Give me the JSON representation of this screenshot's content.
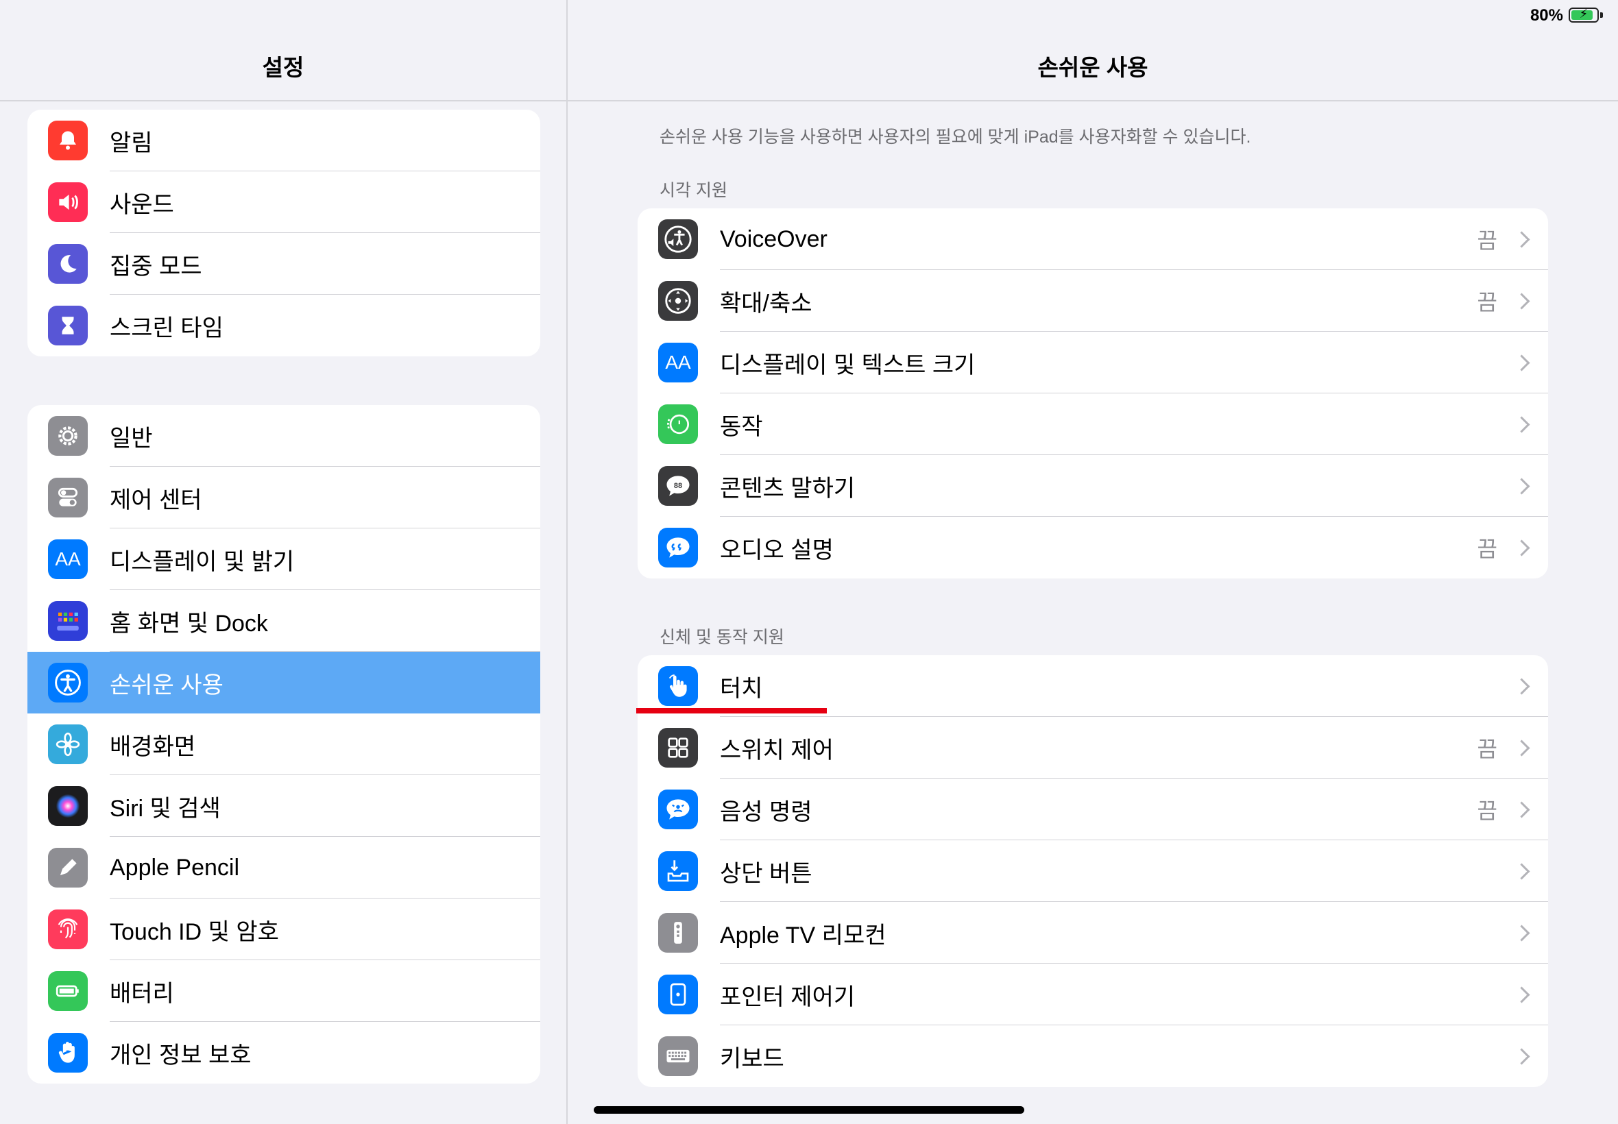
{
  "status_bar": {
    "battery_percent": "80%"
  },
  "sidebar": {
    "title": "설정",
    "group1": [
      {
        "label": "알림",
        "icon": "bell-icon",
        "color": "#ff3b30"
      },
      {
        "label": "사운드",
        "icon": "speaker-icon",
        "color": "#ff2d55"
      },
      {
        "label": "집중 모드",
        "icon": "moon-icon",
        "color": "#5856d6"
      },
      {
        "label": "스크린 타임",
        "icon": "hourglass-icon",
        "color": "#5856d6"
      }
    ],
    "group2": [
      {
        "label": "일반",
        "icon": "gear-icon",
        "color": "#8e8e93"
      },
      {
        "label": "제어 센터",
        "icon": "toggles-icon",
        "color": "#8e8e93"
      },
      {
        "label": "디스플레이 및 밝기",
        "icon": "text-size-icon",
        "color": "#007aff"
      },
      {
        "label": "홈 화면 및 Dock",
        "icon": "home-grid-icon",
        "color": "#2f3ed8"
      },
      {
        "label": "손쉬운 사용",
        "icon": "accessibility-icon",
        "color": "#007aff",
        "selected": true
      },
      {
        "label": "배경화면",
        "icon": "flower-icon",
        "color": "#34aadc"
      },
      {
        "label": "Siri 및 검색",
        "icon": "siri-icon",
        "color": "#1c1c1e"
      },
      {
        "label": "Apple Pencil",
        "icon": "pencil-icon",
        "color": "#8e8e93"
      },
      {
        "label": "Touch ID 및 암호",
        "icon": "fingerprint-icon",
        "color": "#ff3b5c"
      },
      {
        "label": "배터리",
        "icon": "battery-icon",
        "color": "#34c759"
      },
      {
        "label": "개인 정보 보호",
        "icon": "hand-icon",
        "color": "#007aff"
      }
    ]
  },
  "main": {
    "title": "손쉬운 사용",
    "intro": "손쉬운 사용 기능을 사용하면 사용자의 필요에 맞게 iPad를 사용자화할 수 있습니다.",
    "section_vision": "시각 지원",
    "vision_items": [
      {
        "label": "VoiceOver",
        "value": "끔",
        "icon": "voiceover-icon",
        "color": "#3a3a3c"
      },
      {
        "label": "확대/축소",
        "value": "끔",
        "icon": "zoom-icon",
        "color": "#3a3a3c"
      },
      {
        "label": "디스플레이 및 텍스트 크기",
        "value": "",
        "icon": "text-size-icon",
        "color": "#007aff"
      },
      {
        "label": "동작",
        "value": "",
        "icon": "motion-icon",
        "color": "#34c759"
      },
      {
        "label": "콘텐츠 말하기",
        "value": "",
        "icon": "speech-bubble-icon",
        "color": "#3a3a3c"
      },
      {
        "label": "오디오 설명",
        "value": "끔",
        "icon": "audio-description-icon",
        "color": "#007aff"
      }
    ],
    "section_physical": "신체 및 동작 지원",
    "physical_items": [
      {
        "label": "터치",
        "value": "",
        "icon": "touch-hand-icon",
        "color": "#007aff"
      },
      {
        "label": "스위치 제어",
        "value": "끔",
        "icon": "switch-grid-icon",
        "color": "#3a3a3c"
      },
      {
        "label": "음성 명령",
        "value": "끔",
        "icon": "voice-control-icon",
        "color": "#007aff"
      },
      {
        "label": "상단 버튼",
        "value": "",
        "icon": "top-button-icon",
        "color": "#007aff"
      },
      {
        "label": "Apple TV 리모컨",
        "value": "",
        "icon": "remote-icon",
        "color": "#8e8e93"
      },
      {
        "label": "포인터 제어기",
        "value": "",
        "icon": "pointer-icon",
        "color": "#007aff"
      },
      {
        "label": "키보드",
        "value": "",
        "icon": "keyboard-icon",
        "color": "#8e8e93"
      }
    ]
  }
}
